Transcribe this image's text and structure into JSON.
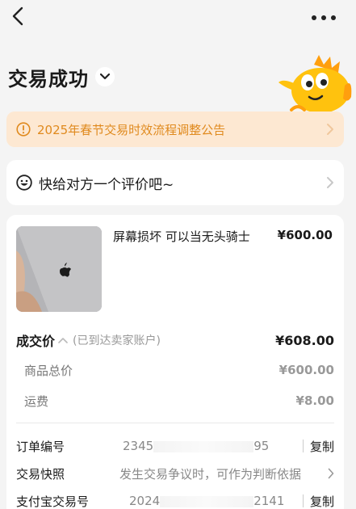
{
  "header": {
    "title": "交易成功"
  },
  "notice": {
    "text": "2025年春节交易时效流程调整公告"
  },
  "review": {
    "text": "快给对方一个评价吧~"
  },
  "product": {
    "title": "屏幕损坏 可以当无头骑士",
    "price": "¥600.00"
  },
  "deal": {
    "label": "成交价",
    "note": "(已到达卖家账户)",
    "price": "¥608.00",
    "rows": [
      {
        "label": "商品总价",
        "value": "¥600.00"
      },
      {
        "label": "运费",
        "value": "¥8.00"
      }
    ]
  },
  "info": {
    "order_no": {
      "label": "订单编号",
      "value_start": "2345",
      "value_end": "95",
      "action": "复制"
    },
    "snapshot": {
      "label": "交易快照",
      "value": "发生交易争议时，可作为判断依据"
    },
    "alipay_no": {
      "label": "支付宝交易号",
      "value_start": "2024",
      "value_end": "2141",
      "action": "复制"
    }
  },
  "colors": {
    "accent": "#e08a1e",
    "notice_bg": "#fde8d2",
    "page_bg": "#f4f4f4",
    "mascot": "#ffc20e"
  }
}
